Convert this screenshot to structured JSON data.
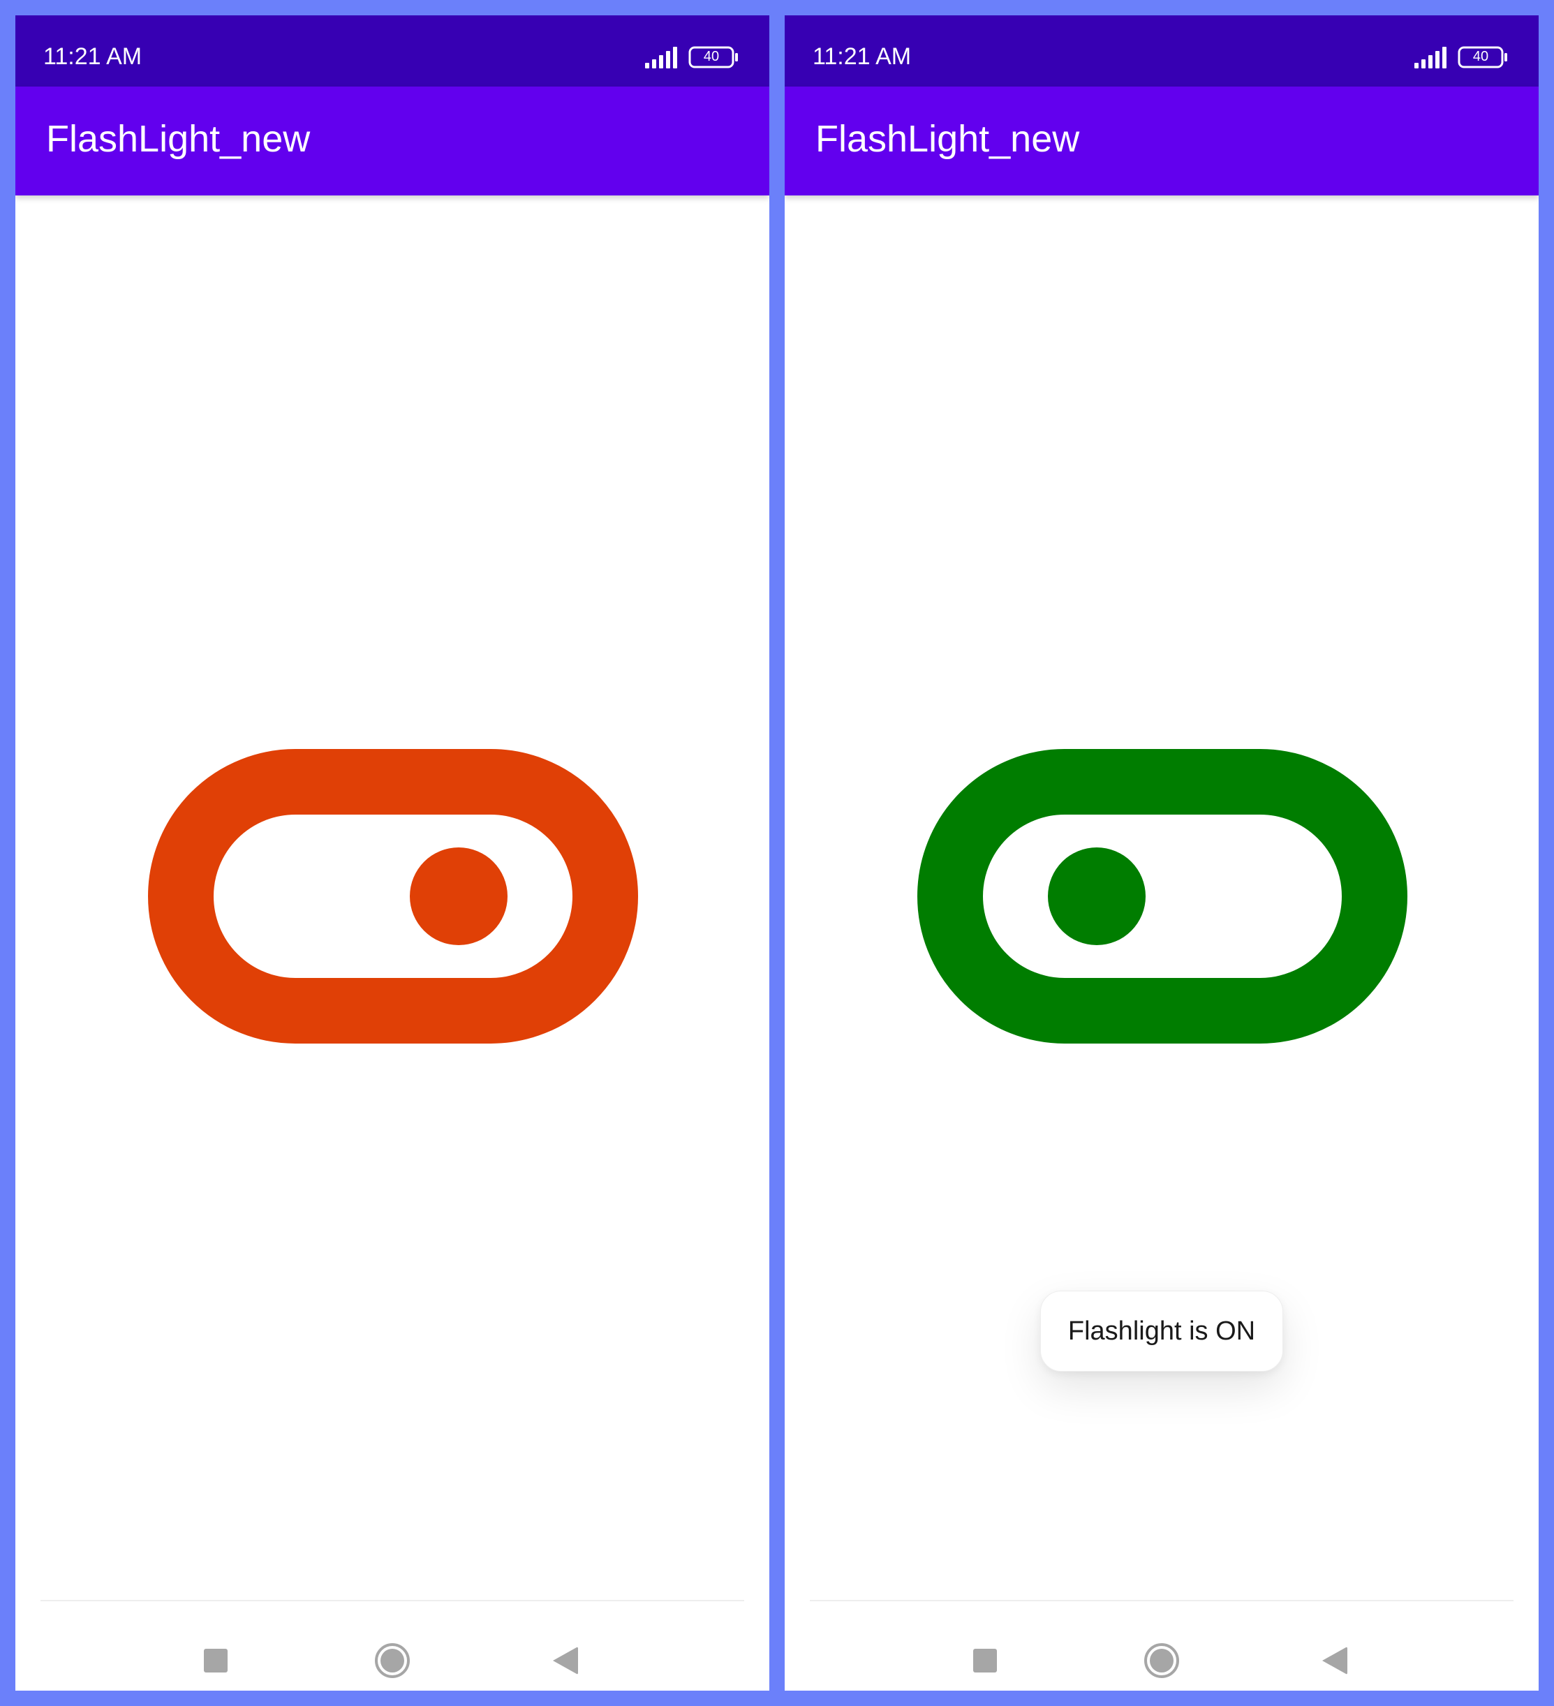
{
  "screens": [
    {
      "status_bar": {
        "time": "11:21 AM",
        "signal_icon": "signal-bars-icon",
        "battery_level": "40"
      },
      "app_bar": {
        "title": "FlashLight_new"
      },
      "toggle": {
        "state": "off",
        "color": "#E04006",
        "icon": "toggle-off-icon"
      },
      "toast": null,
      "nav_bar": {
        "recents_icon": "square-icon",
        "home_icon": "circle-icon",
        "back_icon": "triangle-back-icon"
      }
    },
    {
      "status_bar": {
        "time": "11:21 AM",
        "signal_icon": "signal-bars-icon",
        "battery_level": "40"
      },
      "app_bar": {
        "title": "FlashLight_new"
      },
      "toggle": {
        "state": "on",
        "color": "#007D00",
        "icon": "toggle-on-icon"
      },
      "toast": {
        "text": "Flashlight is ON"
      },
      "nav_bar": {
        "recents_icon": "square-icon",
        "home_icon": "circle-icon",
        "back_icon": "triangle-back-icon"
      }
    }
  ],
  "theme": {
    "background": "#6B80FA",
    "status_bar_color": "#3700B3",
    "app_bar_color": "#6200EE",
    "nav_icon_color": "#A6A6A6"
  }
}
